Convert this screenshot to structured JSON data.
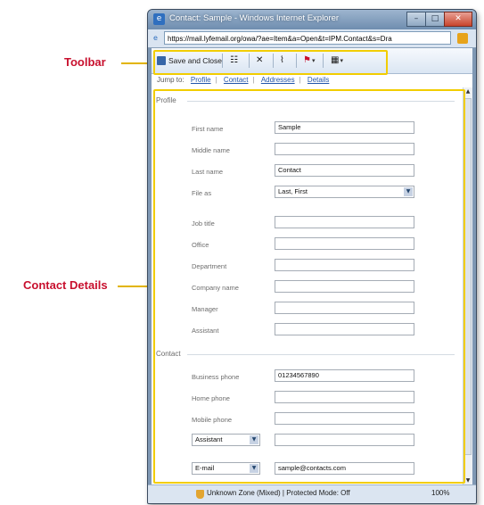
{
  "annotations": {
    "toolbar_callout": "Toolbar",
    "details_callout": "Contact Details"
  },
  "window": {
    "title": "Contact: Sample - Windows Internet Explorer",
    "minimize": "–",
    "maximize": "□",
    "close": "✕",
    "address": "https://mail.lyfemail.org/owa/?ae=Item&a=Open&t=IPM.Contact&s=Dra"
  },
  "toolbar": {
    "save_close": "Save and Close",
    "address_book_icon": "address-book-icon",
    "delete_icon": "delete-icon",
    "attach_icon": "paperclip-icon",
    "flag_icon": "flag-icon",
    "categories_icon": "categories-icon"
  },
  "jumpbar": {
    "label": "Jump to:",
    "links": [
      "Profile",
      "Contact",
      "Addresses",
      "Details"
    ]
  },
  "form": {
    "profile_section": "Profile",
    "contact_section": "Contact",
    "profile_fields": [
      {
        "label": "First name",
        "value": "Sample"
      },
      {
        "label": "Middle name",
        "value": ""
      },
      {
        "label": "Last name",
        "value": "Contact"
      },
      {
        "label": "File as",
        "value": "Last, First"
      },
      {
        "label": "Job title",
        "value": ""
      },
      {
        "label": "Office",
        "value": ""
      },
      {
        "label": "Department",
        "value": ""
      },
      {
        "label": "Company name",
        "value": ""
      },
      {
        "label": "Manager",
        "value": ""
      },
      {
        "label": "Assistant",
        "value": ""
      }
    ],
    "contact_fields": [
      {
        "label": "Business phone",
        "value": "01234567890"
      },
      {
        "label": "Home phone",
        "value": ""
      },
      {
        "label": "Mobile phone",
        "value": ""
      }
    ],
    "assistant_select": "Assistant",
    "assistant_value": "",
    "email_select": "E-mail",
    "email_value": "sample@contacts.com"
  },
  "statusbar": {
    "zone": "Unknown Zone (Mixed) | Protected Mode: Off",
    "zoom": "100%"
  },
  "colors": {
    "callout": "#c8102e",
    "highlight": "#f2cd00"
  }
}
